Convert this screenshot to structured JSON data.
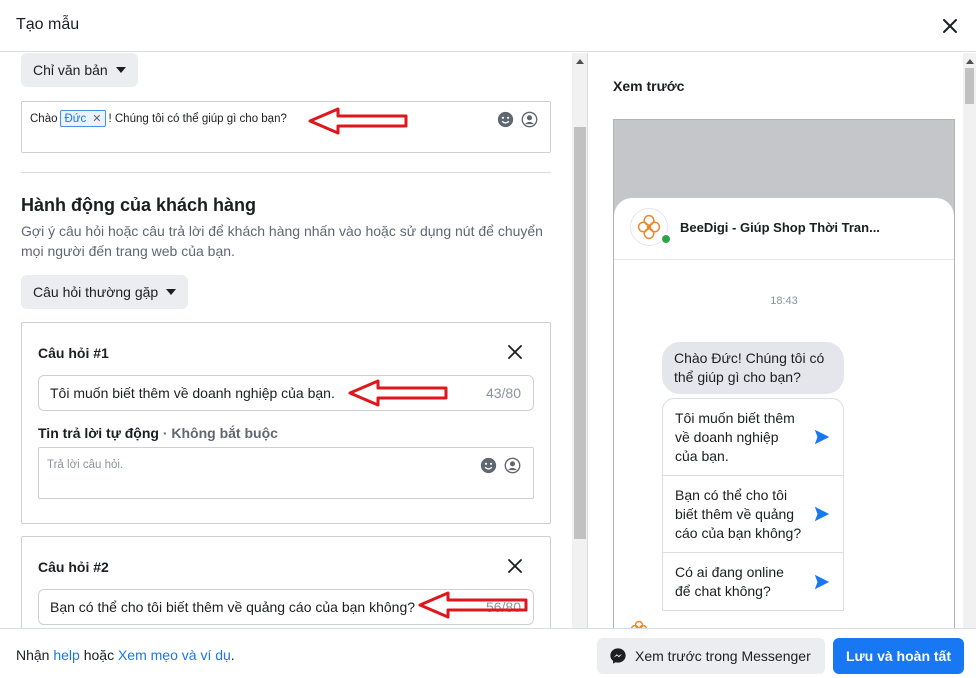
{
  "header": {
    "title": "Tạo mẫu"
  },
  "message_type": {
    "label": "Chỉ văn bản"
  },
  "greeting": {
    "prefix": "Chào",
    "token": "Đức",
    "suffix": "! Chúng tôi có thể giúp gì cho bạn?"
  },
  "customer_action": {
    "title": "Hành động của khách hàng",
    "description": "Gợi ý câu hỏi hoặc câu trả lời để khách hàng nhấn vào hoặc sử dụng nút để chuyển mọi người đến trang web của bạn.",
    "type_label": "Câu hỏi thường gặp"
  },
  "questions": [
    {
      "label": "Câu hỏi #1",
      "value": "Tôi muốn biết thêm về doanh nghiệp của bạn.",
      "count": "43/80",
      "reply_label": "Tin trả lời tự động",
      "reply_optional": " · Không bắt buộc",
      "reply_placeholder": "Trả lời câu hỏi."
    },
    {
      "label": "Câu hỏi #2",
      "value": "Bạn có thể cho tôi biết thêm về quảng cáo của bạn không?",
      "count": "56/80"
    }
  ],
  "preview": {
    "title": "Xem trước",
    "page_name": "BeeDigi - Giúp Shop Thời Tran...",
    "time": "18:43",
    "greeting_bubble": "Chào Đức! Chúng tôi có thể giúp gì cho bạn?",
    "quick_replies": [
      "Tôi muốn biết thêm về doanh nghiệp của bạn.",
      "Bạn có thể cho tôi biết thêm về quảng cáo của bạn không?",
      "Có ai đang online để chat không?"
    ]
  },
  "footer": {
    "help_prefix": "Nhận ",
    "help_link": "help",
    "help_mid": " hoặc ",
    "tips_link": "Xem mẹo và ví dụ",
    "help_suffix": ".",
    "preview_button": "Xem trước trong Messenger",
    "save_button": "Lưu và hoàn tất"
  },
  "colors": {
    "accent": "#1877f2",
    "annotation_arrow": "#e0161d",
    "online": "#31a24c"
  },
  "icons": [
    "close-icon",
    "caret-down-icon",
    "emoji-icon",
    "person-icon",
    "send-icon",
    "messenger-icon",
    "brand-logo-icon"
  ]
}
